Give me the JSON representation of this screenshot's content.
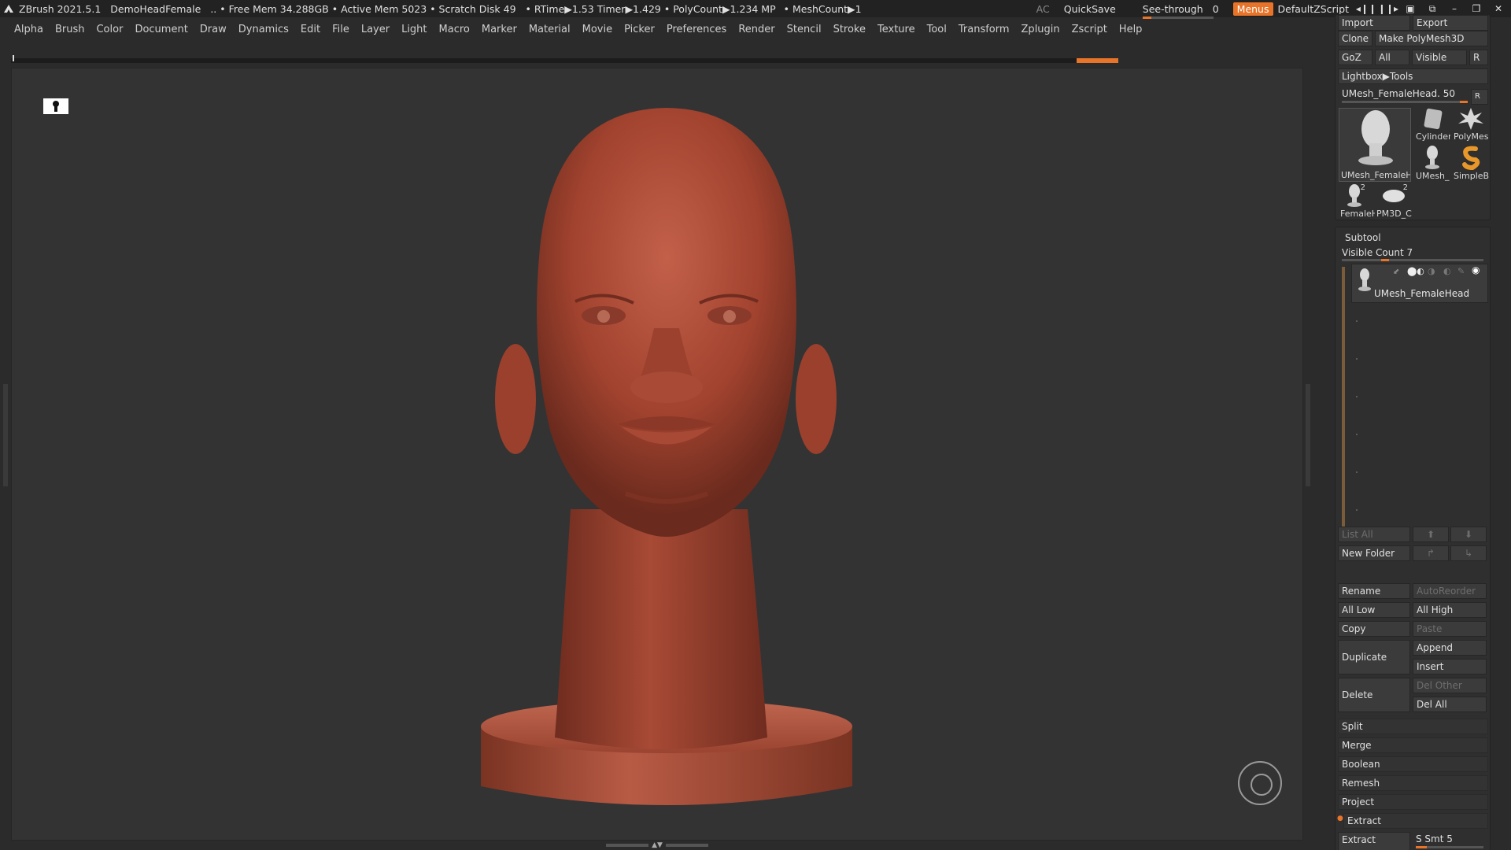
{
  "titlebar": {
    "app": "ZBrush 2021.5.1",
    "document": "DemoHeadFemale",
    "free_mem": "• Free Mem 34.288GB",
    "active_mem": "• Active Mem 5023",
    "scratch": "• Scratch Disk 49",
    "rtime": "• RTime▶1.53",
    "timer": "Timer▶1.429",
    "polycount": "• PolyCount▶1.234 MP",
    "meshcount": "• MeshCount▶1",
    "ac": "AC",
    "quicksave": "QuickSave",
    "see_through": "See-through",
    "see_through_value": "0",
    "see_through_fraction": 0.13,
    "menus": "Menus",
    "script": "DefaultZScript"
  },
  "menubar": [
    "Alpha",
    "Brush",
    "Color",
    "Document",
    "Draw",
    "Dynamics",
    "Edit",
    "File",
    "Layer",
    "Light",
    "Macro",
    "Marker",
    "Material",
    "Movie",
    "Picker",
    "Preferences",
    "Render",
    "Stencil",
    "Stroke",
    "Texture",
    "Tool",
    "Transform",
    "Zplugin",
    "Zscript",
    "Help"
  ],
  "tool": {
    "import": "Import",
    "export": "Export",
    "clone": "Clone",
    "make_polymesh": "Make PolyMesh3D",
    "goz": "GoZ",
    "all": "All",
    "visible": "Visible",
    "r": "R",
    "lightbox": "Lightbox▶Tools",
    "current_tool": "UMesh_FemaleHead. 50",
    "thumbs": {
      "main": "UMesh_FemaleH",
      "cylinder": "Cylinder",
      "polymesh": "PolyMes",
      "umesh": "UMesh_",
      "simpleb": "SimpleB",
      "female": "FemaleH",
      "female_count": "2",
      "pm3d": "PM3D_C",
      "pm3d_count": "2"
    }
  },
  "subtool": {
    "title": "Subtool",
    "visible_count": "Visible Count 7",
    "item_name": "UMesh_FemaleHead",
    "list_all": "List All",
    "new_folder": "New Folder",
    "rename": "Rename",
    "autoreorder": "AutoReorder",
    "all_low": "All Low",
    "all_high": "All High",
    "copy": "Copy",
    "paste": "Paste",
    "duplicate": "Duplicate",
    "append": "Append",
    "insert": "Insert",
    "delete": "Delete",
    "del_other": "Del Other",
    "del_all": "Del All",
    "split": "Split",
    "merge": "Merge",
    "boolean": "Boolean",
    "remesh": "Remesh",
    "project": "Project",
    "extract": "Extract",
    "extract_btn": "Extract",
    "s_smt": "S Smt 5"
  },
  "colors": {
    "accent": "#e8742a",
    "clay": "#a5442f",
    "viewport_bg": "#333333"
  }
}
